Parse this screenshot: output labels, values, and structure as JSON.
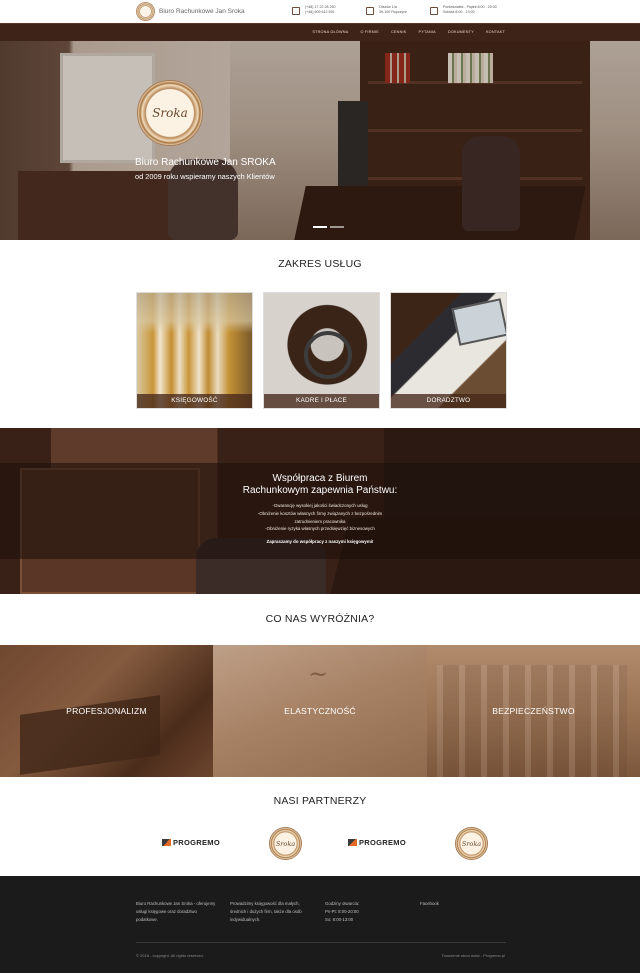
{
  "header": {
    "brand": "Biuro Rachunkowe Jan Sroka",
    "phones": [
      "(+48) 17 22 28 250",
      "(+48) 609 612 592"
    ],
    "address": [
      "Olszów 1/a",
      "39-100 Ropczyce"
    ],
    "hours": [
      "Poniedziałek - Piątek 8:00 - 20:00",
      "Sobota 8:00 - 13:00"
    ],
    "icons": {
      "phone": "phone-icon",
      "address": "home-icon",
      "hours": "clock-icon"
    }
  },
  "nav": {
    "items": [
      "STRONA GŁÓWNA",
      "O FIRMIE",
      "CENNIK",
      "PYTANIA",
      "DOKUMENTY",
      "KONTAKT"
    ]
  },
  "hero": {
    "logo_text": "Sroka",
    "title": "Biuro Rachunkowe Jan SROKA",
    "subtitle": "od 2009 roku wspieramy naszych Klientów"
  },
  "services": {
    "title": "ZAKRES USŁUG",
    "cards": [
      "KSIĘGOWOŚĆ",
      "KADRE I PŁACE",
      "DORADZTWO"
    ]
  },
  "cooperation": {
    "title_line1": "Współpraca z Biurem",
    "title_line2": "Rachunkowym zapewnia Państwu:",
    "bullets": [
      "-Gwarancję wysokiej jakości świadczonych usług",
      "-Obniżenie kosztów własnych firmy związanych z bezpośrednim",
      "zatrudnieniem pracownika",
      "-Obniżenie ryzyka własnych przedsięwzięć biznesowych"
    ],
    "cta": "Zapraszamy do współpracy z naszymi księgowymi!"
  },
  "features": {
    "title": "CO NAS WYRÓŻNIA?",
    "items": [
      "PROFESJONALIZM",
      "ELASTYCZNOŚĆ",
      "BEZPIECZEŃSTWO"
    ]
  },
  "partners": {
    "title": "NASI PARTNERZY",
    "progremo": "PROGREMO",
    "seal_text": "Sroka"
  },
  "footer": {
    "col1": [
      "Biuro Rachunkowe Jan Sroka - oferujemy",
      "usługi księgowe oraz doradztwo",
      "podatkowe."
    ],
    "col2": [
      "Prowadzimy księgowość dla małych,",
      "średnich i dużych firm, także dla osób",
      "indywidualnych."
    ],
    "col3": [
      "Godziny otwarcia:",
      "Pn-Pt: 8:00-20:00",
      "So: 8:00-13:00"
    ],
    "col4": [
      "Facebook"
    ],
    "copyright": "© 2018 - copyright. All rights reserved.",
    "credit": "Tworzenie stron www - Progremo.pl"
  },
  "colors": {
    "nav_bg": "#3e2418",
    "footer_bg": "#1b1b1b",
    "caption_bg": "#462819"
  }
}
